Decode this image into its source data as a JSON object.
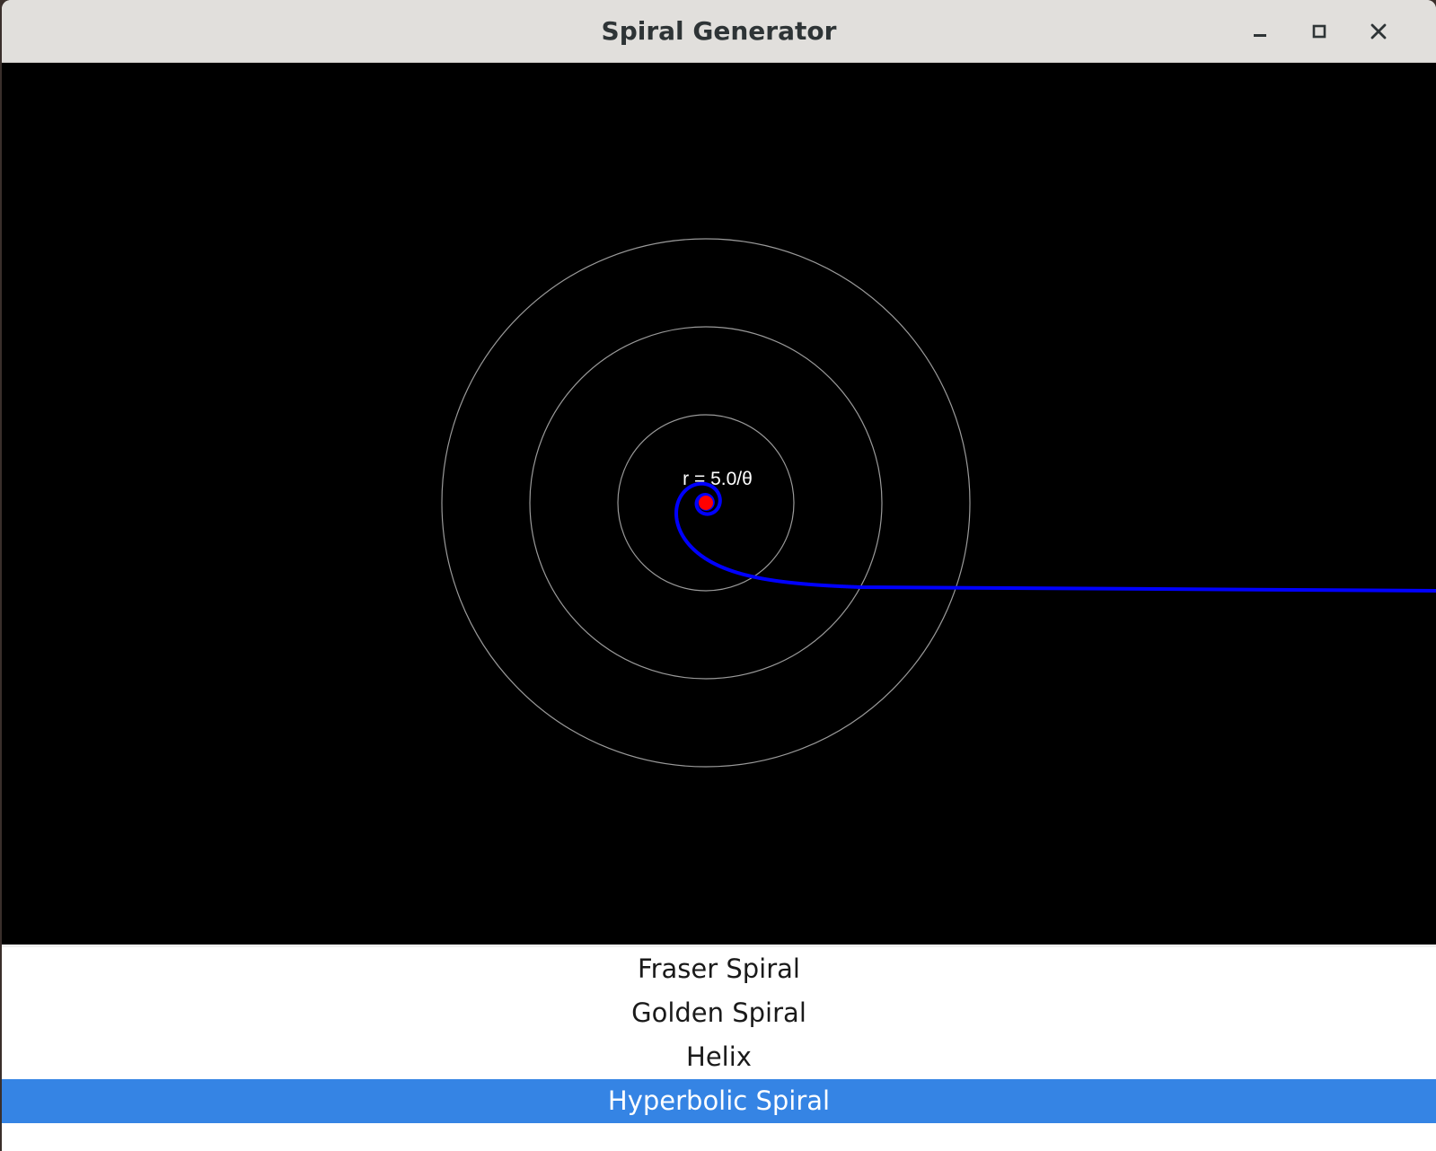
{
  "window": {
    "title": "Spiral Generator"
  },
  "titlebar_buttons": [
    {
      "name": "minimize",
      "icon": "minimize-icon"
    },
    {
      "name": "maximize",
      "icon": "maximize-icon"
    },
    {
      "name": "close",
      "icon": "close-icon"
    }
  ],
  "canvas": {
    "background": "#000000",
    "equation_label": "r = 5.0/θ",
    "spiral": {
      "type": "hyperbolic",
      "a": 5.0,
      "color": "#0000ff"
    },
    "grid_circle_color": "#9a9a9a",
    "center_dot_color": "#ff0000"
  },
  "spiral_list": {
    "items": [
      {
        "label": "Fraser Spiral",
        "selected": false
      },
      {
        "label": "Golden Spiral",
        "selected": false
      },
      {
        "label": "Helix",
        "selected": false
      },
      {
        "label": "Hyperbolic Spiral",
        "selected": true
      }
    ],
    "selected_color": "#3584e4"
  }
}
